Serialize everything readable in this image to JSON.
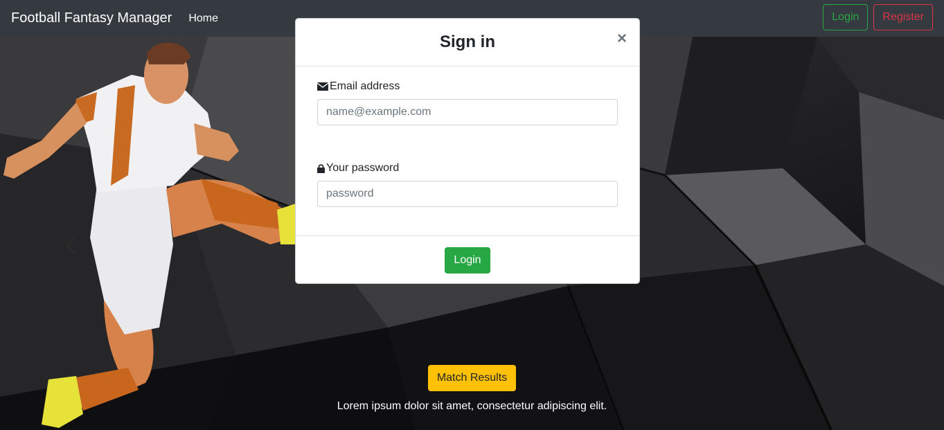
{
  "navbar": {
    "brand": "Football Fantasy Manager",
    "home_label": "Home",
    "login_label": "Login",
    "register_label": "Register"
  },
  "hero": {
    "cta_label": "Match Results",
    "caption": "Lorem ipsum dolor sit amet, consectetur adipiscing elit.",
    "prev_icon": "chevron-left-icon"
  },
  "modal": {
    "title": "Sign in",
    "close_symbol": "×",
    "email_label": "Email address",
    "email_placeholder": "name@example.com",
    "password_label": "Your password",
    "password_placeholder": "password",
    "submit_label": "Login"
  },
  "colors": {
    "navbar_bg": "#343a40",
    "success": "#28a745",
    "danger": "#dc3545",
    "warning": "#ffc107"
  }
}
